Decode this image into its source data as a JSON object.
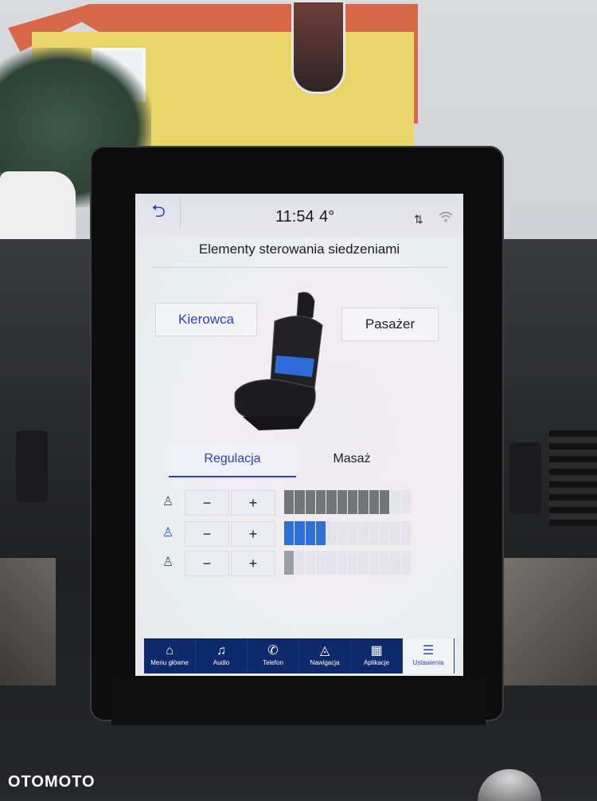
{
  "status_bar": {
    "time": "11:54",
    "temperature": "4°",
    "back_icon": "back-arrow-icon",
    "signal_icon": "signal-icon",
    "wifi_icon": "wifi-icon"
  },
  "page": {
    "title": "Elementy sterowania siedzeniami"
  },
  "seat_select": {
    "driver_label": "Kierowca",
    "passenger_label": "Pasażer",
    "selected": "Kierowca"
  },
  "tabs": [
    {
      "label": "Regulacja",
      "active": true
    },
    {
      "label": "Masaż",
      "active": false
    }
  ],
  "adjust_rows": [
    {
      "icon": "seat-back-icon",
      "minus": "−",
      "plus": "+",
      "level_fraction": 0.83,
      "color": "#6f7675"
    },
    {
      "icon": "seat-lumbar-icon",
      "minus": "−",
      "plus": "+",
      "level_fraction": 0.3,
      "color": "#2f6fd8"
    },
    {
      "icon": "seat-cushion-icon",
      "minus": "−",
      "plus": "+",
      "level_fraction": 0.1,
      "color": "#9aa0a1"
    }
  ],
  "nav": [
    {
      "icon": "home-icon",
      "label": "Menu główne",
      "active": false
    },
    {
      "icon": "music-note-icon",
      "label": "Audio",
      "active": false
    },
    {
      "icon": "phone-icon",
      "label": "Telefon",
      "active": false
    },
    {
      "icon": "navigation-icon",
      "label": "Nawigacja",
      "active": false
    },
    {
      "icon": "apps-grid-icon",
      "label": "Aplikacje",
      "active": false
    },
    {
      "icon": "settings-sliders-icon",
      "label": "Ustawienia",
      "active": true
    }
  ],
  "colors": {
    "accent": "#2a3fc1",
    "nav_bg": "#0d2a6b"
  },
  "watermark": "OTOMOTO"
}
